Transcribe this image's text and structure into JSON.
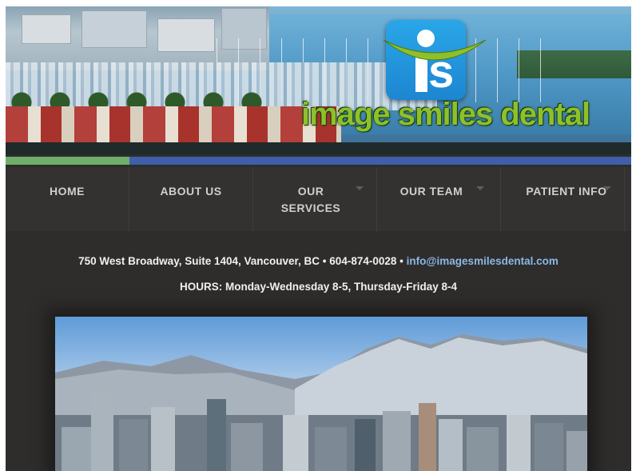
{
  "brand": {
    "logo_mark": "is",
    "logo_text": "image smiles dental",
    "colors": {
      "logo_blue": "#1d86d1",
      "logo_green": "#8ec02a",
      "accent_blue": "#3f5fa8",
      "accent_green": "#6faf6b",
      "email_link": "#8ab8e6"
    }
  },
  "nav": {
    "items": [
      {
        "label": "HOME",
        "has_submenu": false,
        "active": true
      },
      {
        "label": "ABOUT US",
        "has_submenu": false,
        "active": false
      },
      {
        "label": "OUR SERVICES",
        "has_submenu": true,
        "active": false
      },
      {
        "label": "OUR TEAM",
        "has_submenu": true,
        "active": false
      },
      {
        "label": "PATIENT INFO",
        "has_submenu": true,
        "active": false
      }
    ]
  },
  "contact": {
    "address": "750 West Broadway, Suite 1404, Vancouver, BC",
    "separator": "•",
    "phone": "604-874-0028",
    "email": "info@imagesmilesdental.com"
  },
  "hours": {
    "text": "HOURS: Monday-Wednesday 8-5, Thursday-Friday 8-4"
  }
}
